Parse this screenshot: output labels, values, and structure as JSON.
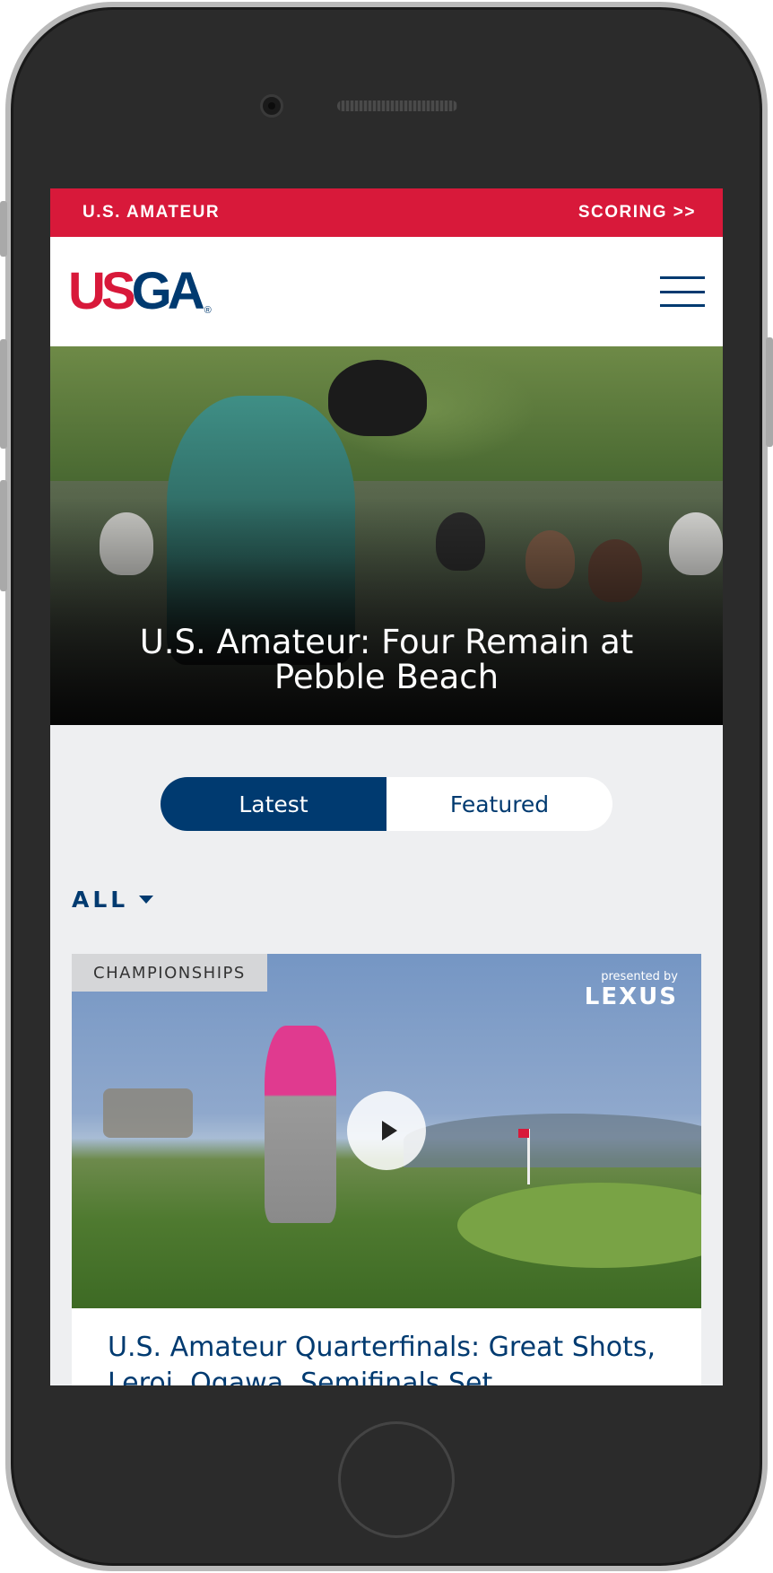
{
  "topbar": {
    "event": "U.S. AMATEUR",
    "scoring": "SCORING >>"
  },
  "header": {
    "logo_us": "US",
    "logo_ga": "GA",
    "logo_reg": "®"
  },
  "hero": {
    "title": "U.S. Amateur: Four Remain at Pebble Beach"
  },
  "tabs": [
    {
      "label": "Latest",
      "active": true
    },
    {
      "label": "Featured",
      "active": false
    }
  ],
  "filter": {
    "label": "ALL"
  },
  "card": {
    "category": "CHAMPIONSHIPS",
    "sponsor_prefix": "presented by",
    "sponsor_brand": "LEXUS",
    "title": "U.S. Amateur Quarterfinals: Great Shots, Leroi, Ogawa, Semifinals Set"
  },
  "colors": {
    "brand_red": "#d8193a",
    "brand_navy": "#003a70",
    "page_bg": "#eeeff1"
  }
}
